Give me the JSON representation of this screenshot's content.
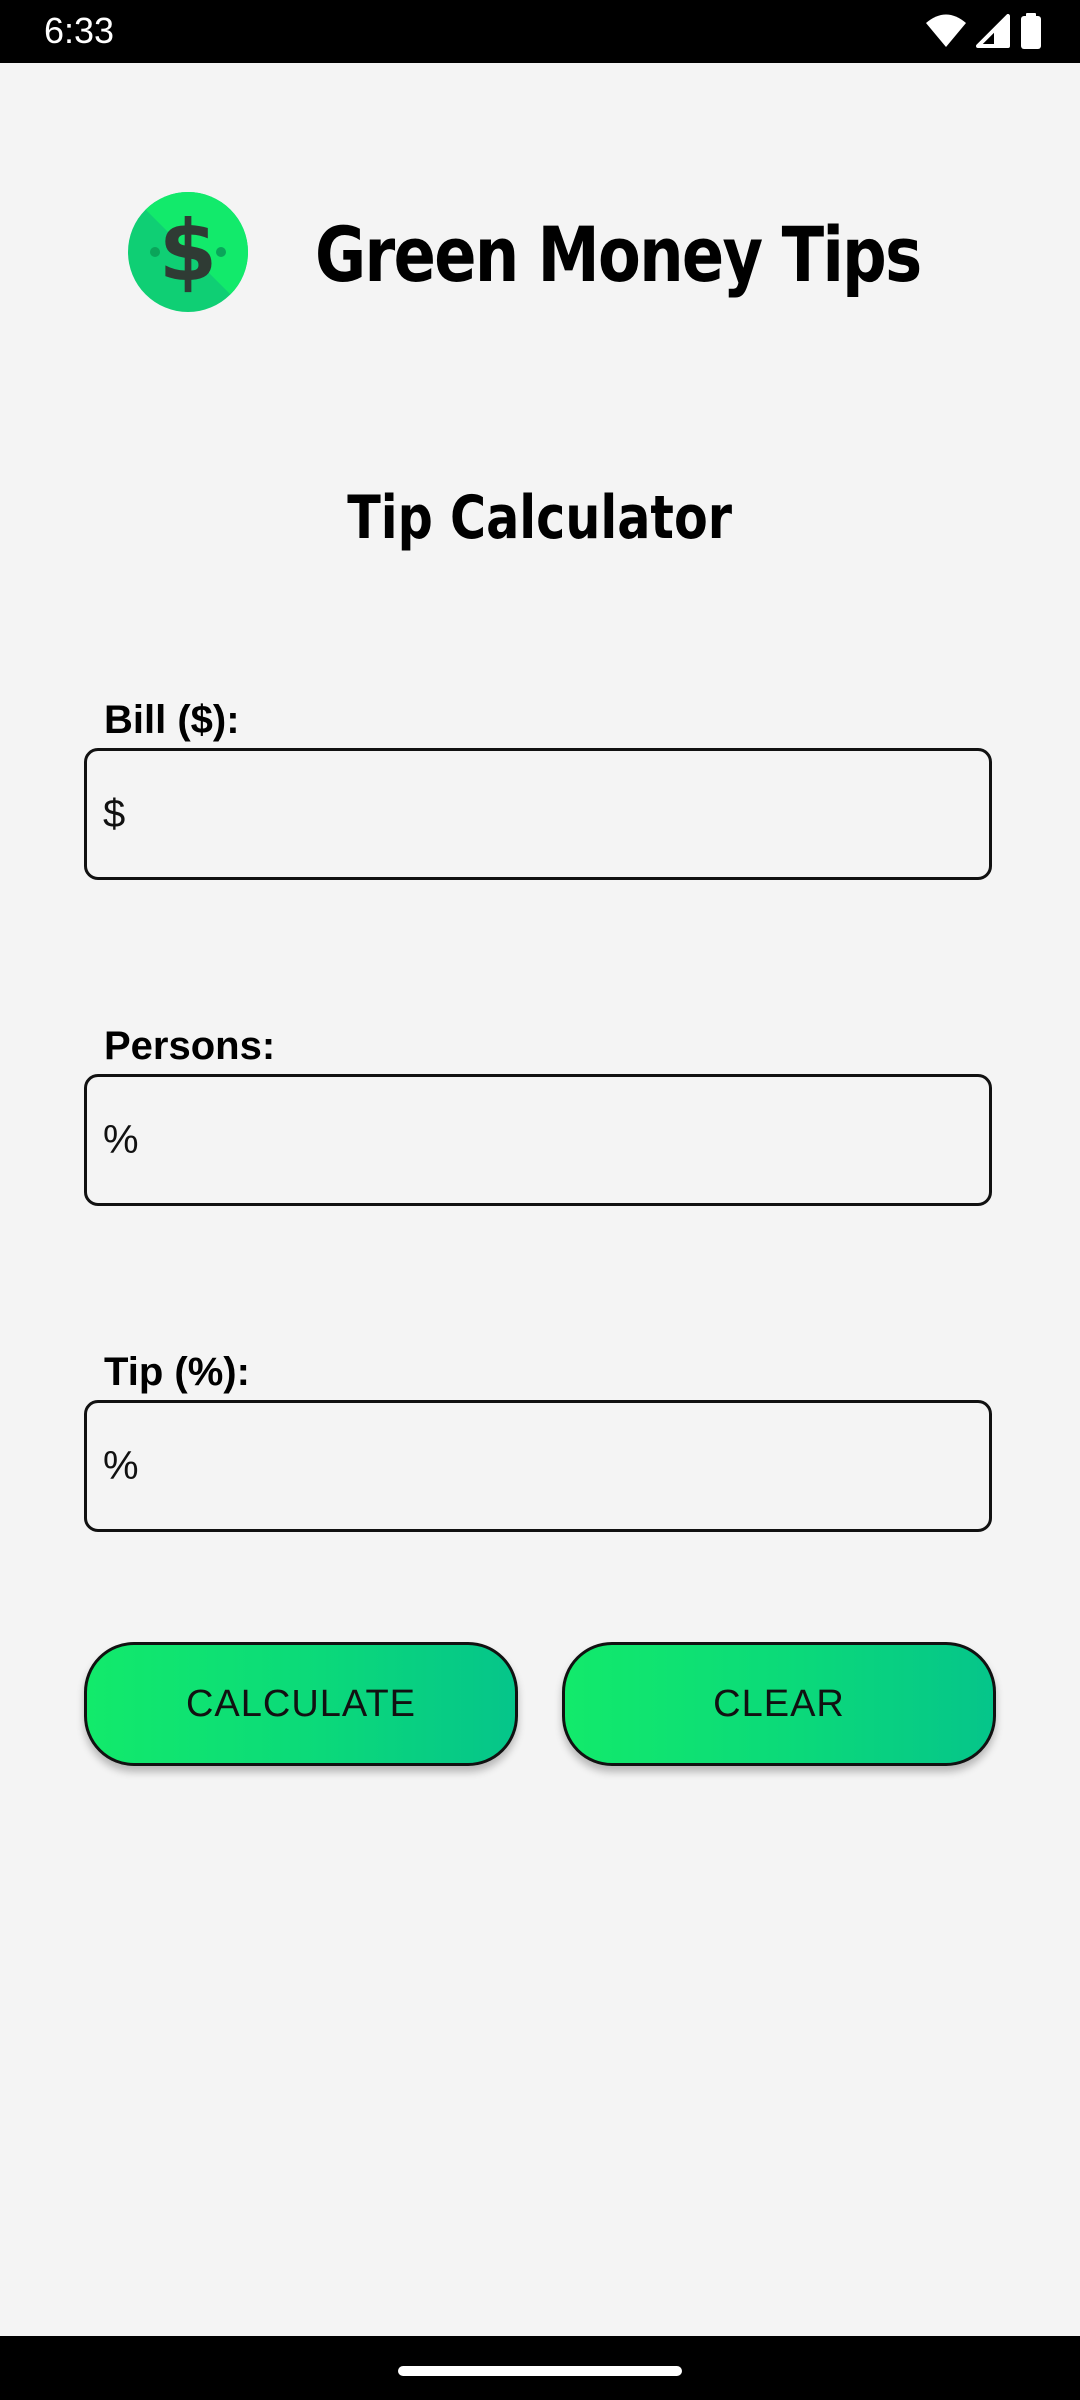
{
  "status_bar": {
    "time": "6:33",
    "icons": [
      "wifi-icon",
      "signal-icon",
      "battery-icon"
    ]
  },
  "header": {
    "app_title": "Green Money Tips",
    "logo_icon": "dollar-coin-icon"
  },
  "main": {
    "page_title": "Tip Calculator",
    "fields": {
      "bill": {
        "label": "Bill ($):",
        "placeholder": "$",
        "value": ""
      },
      "persons": {
        "label": "Persons:",
        "placeholder": "%",
        "value": ""
      },
      "tip": {
        "label": "Tip (%):",
        "placeholder": "%",
        "value": ""
      }
    },
    "buttons": {
      "calculate": "CALCULATE",
      "clear": "CLEAR"
    }
  },
  "colors": {
    "background": "#f4f4f4",
    "accent_green": "#12ea6b",
    "accent_teal": "#05c58a",
    "bars": "#000000"
  }
}
